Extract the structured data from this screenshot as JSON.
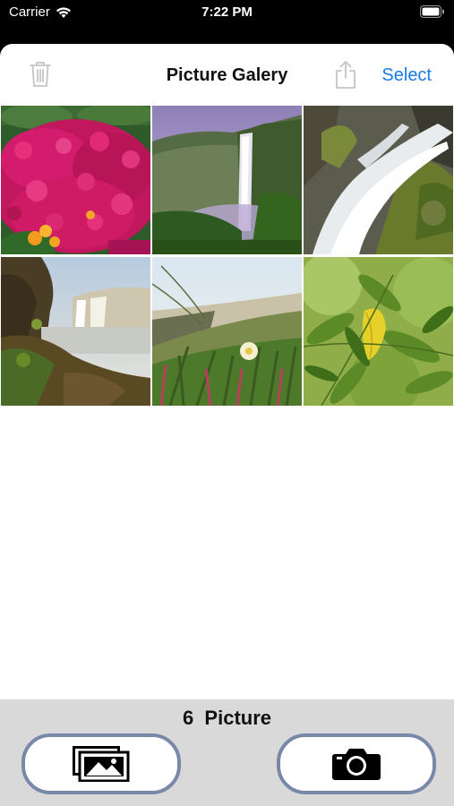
{
  "status": {
    "carrier": "Carrier",
    "time": "7:22 PM"
  },
  "nav": {
    "title": "Picture Galery",
    "select_label": "Select"
  },
  "gallery": {
    "photos": [
      {
        "subject": "pink-flowers"
      },
      {
        "subject": "waterfall-valley"
      },
      {
        "subject": "waterfall-closeup"
      },
      {
        "subject": "waterfall-cliff"
      },
      {
        "subject": "beach-grass-flower"
      },
      {
        "subject": "green-leaves"
      }
    ]
  },
  "footer": {
    "count_text": "6  Picture"
  },
  "colors": {
    "accent": "#1a7ae8",
    "footer_bg": "#d9d9d9",
    "pill_border": "#7888a8"
  },
  "icons": [
    "wifi-icon",
    "battery-icon",
    "trash-icon",
    "share-icon",
    "photo-library-icon",
    "camera-icon"
  ]
}
